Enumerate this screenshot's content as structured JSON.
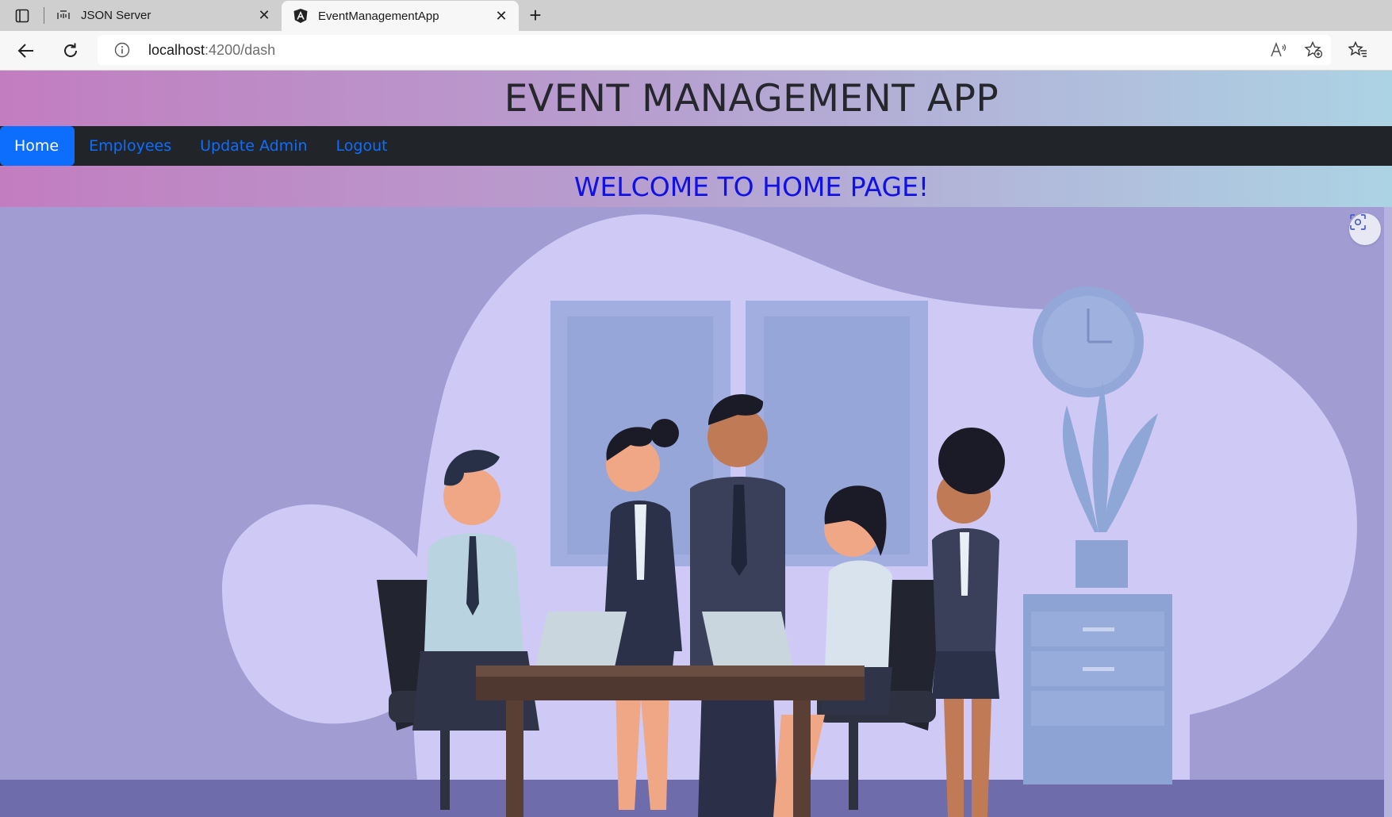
{
  "browser": {
    "tabs": [
      {
        "title": "JSON Server",
        "icon": "json-server-icon",
        "active": false
      },
      {
        "title": "EventManagementApp",
        "icon": "angular-icon",
        "active": true
      }
    ],
    "address": {
      "host": "localhost",
      "path": ":4200/dash"
    }
  },
  "app": {
    "title": "EVENT MANAGEMENT APP",
    "nav": [
      {
        "label": "Home",
        "active": true
      },
      {
        "label": "Employees",
        "active": false
      },
      {
        "label": "Update Admin",
        "active": false
      },
      {
        "label": "Logout",
        "active": false
      }
    ],
    "welcome": "WELCOME TO HOME PAGE!",
    "hero_image": "office-team-meeting-illustration"
  },
  "colors": {
    "banner_gradient": [
      "#c27dc0",
      "#b6a2d1",
      "#acd3e4"
    ],
    "navbar_bg": "#212529",
    "nav_link": "#0d6efd",
    "welcome_text": "#1010e8",
    "hero_bg": "#a19dd3"
  }
}
